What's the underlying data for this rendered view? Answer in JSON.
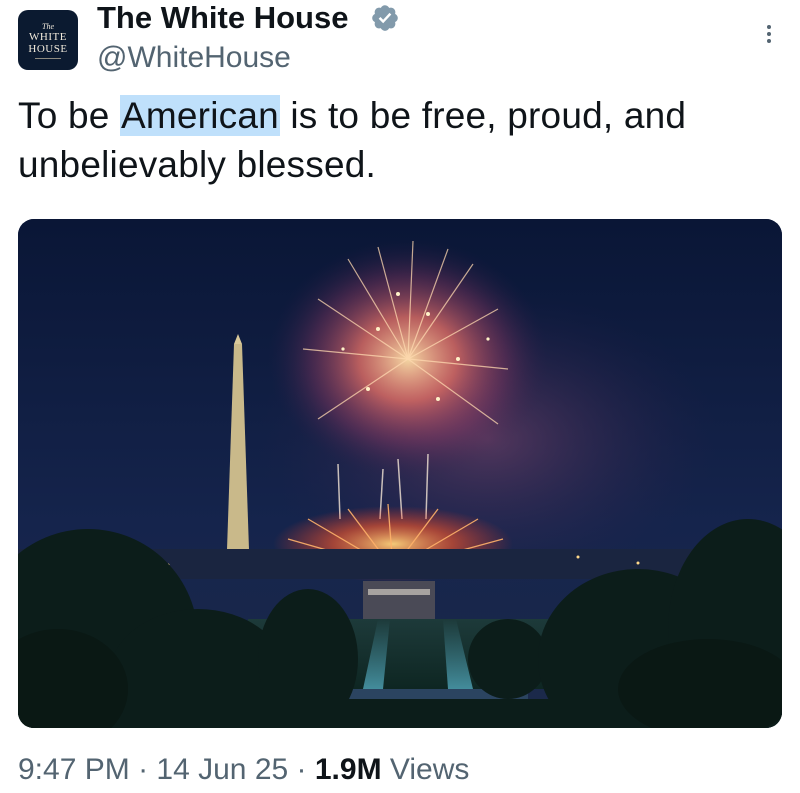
{
  "account": {
    "avatar": {
      "line1": "The",
      "line2": "WHITE",
      "line3": "HOUSE"
    },
    "display_name": "The White House",
    "handle": "@WhiteHouse",
    "verified_icon": "verified-badge-icon"
  },
  "post": {
    "text_before": "To be ",
    "highlighted_word": "American",
    "text_after": " is to be free, proud, and unbelievably blessed.",
    "media": {
      "icon": "photo-fireworks-washington-monument"
    }
  },
  "meta": {
    "time": "9:47 PM",
    "separator1": " · ",
    "date": "14 Jun 25",
    "separator2": " · ",
    "views_count": "1.9M",
    "views_label": " Views"
  },
  "colors": {
    "text": "#0f1419",
    "secondary": "#536471",
    "highlight": "#bfe0fb",
    "verified": "#829aab",
    "night_sky": "#0d1a3a"
  }
}
